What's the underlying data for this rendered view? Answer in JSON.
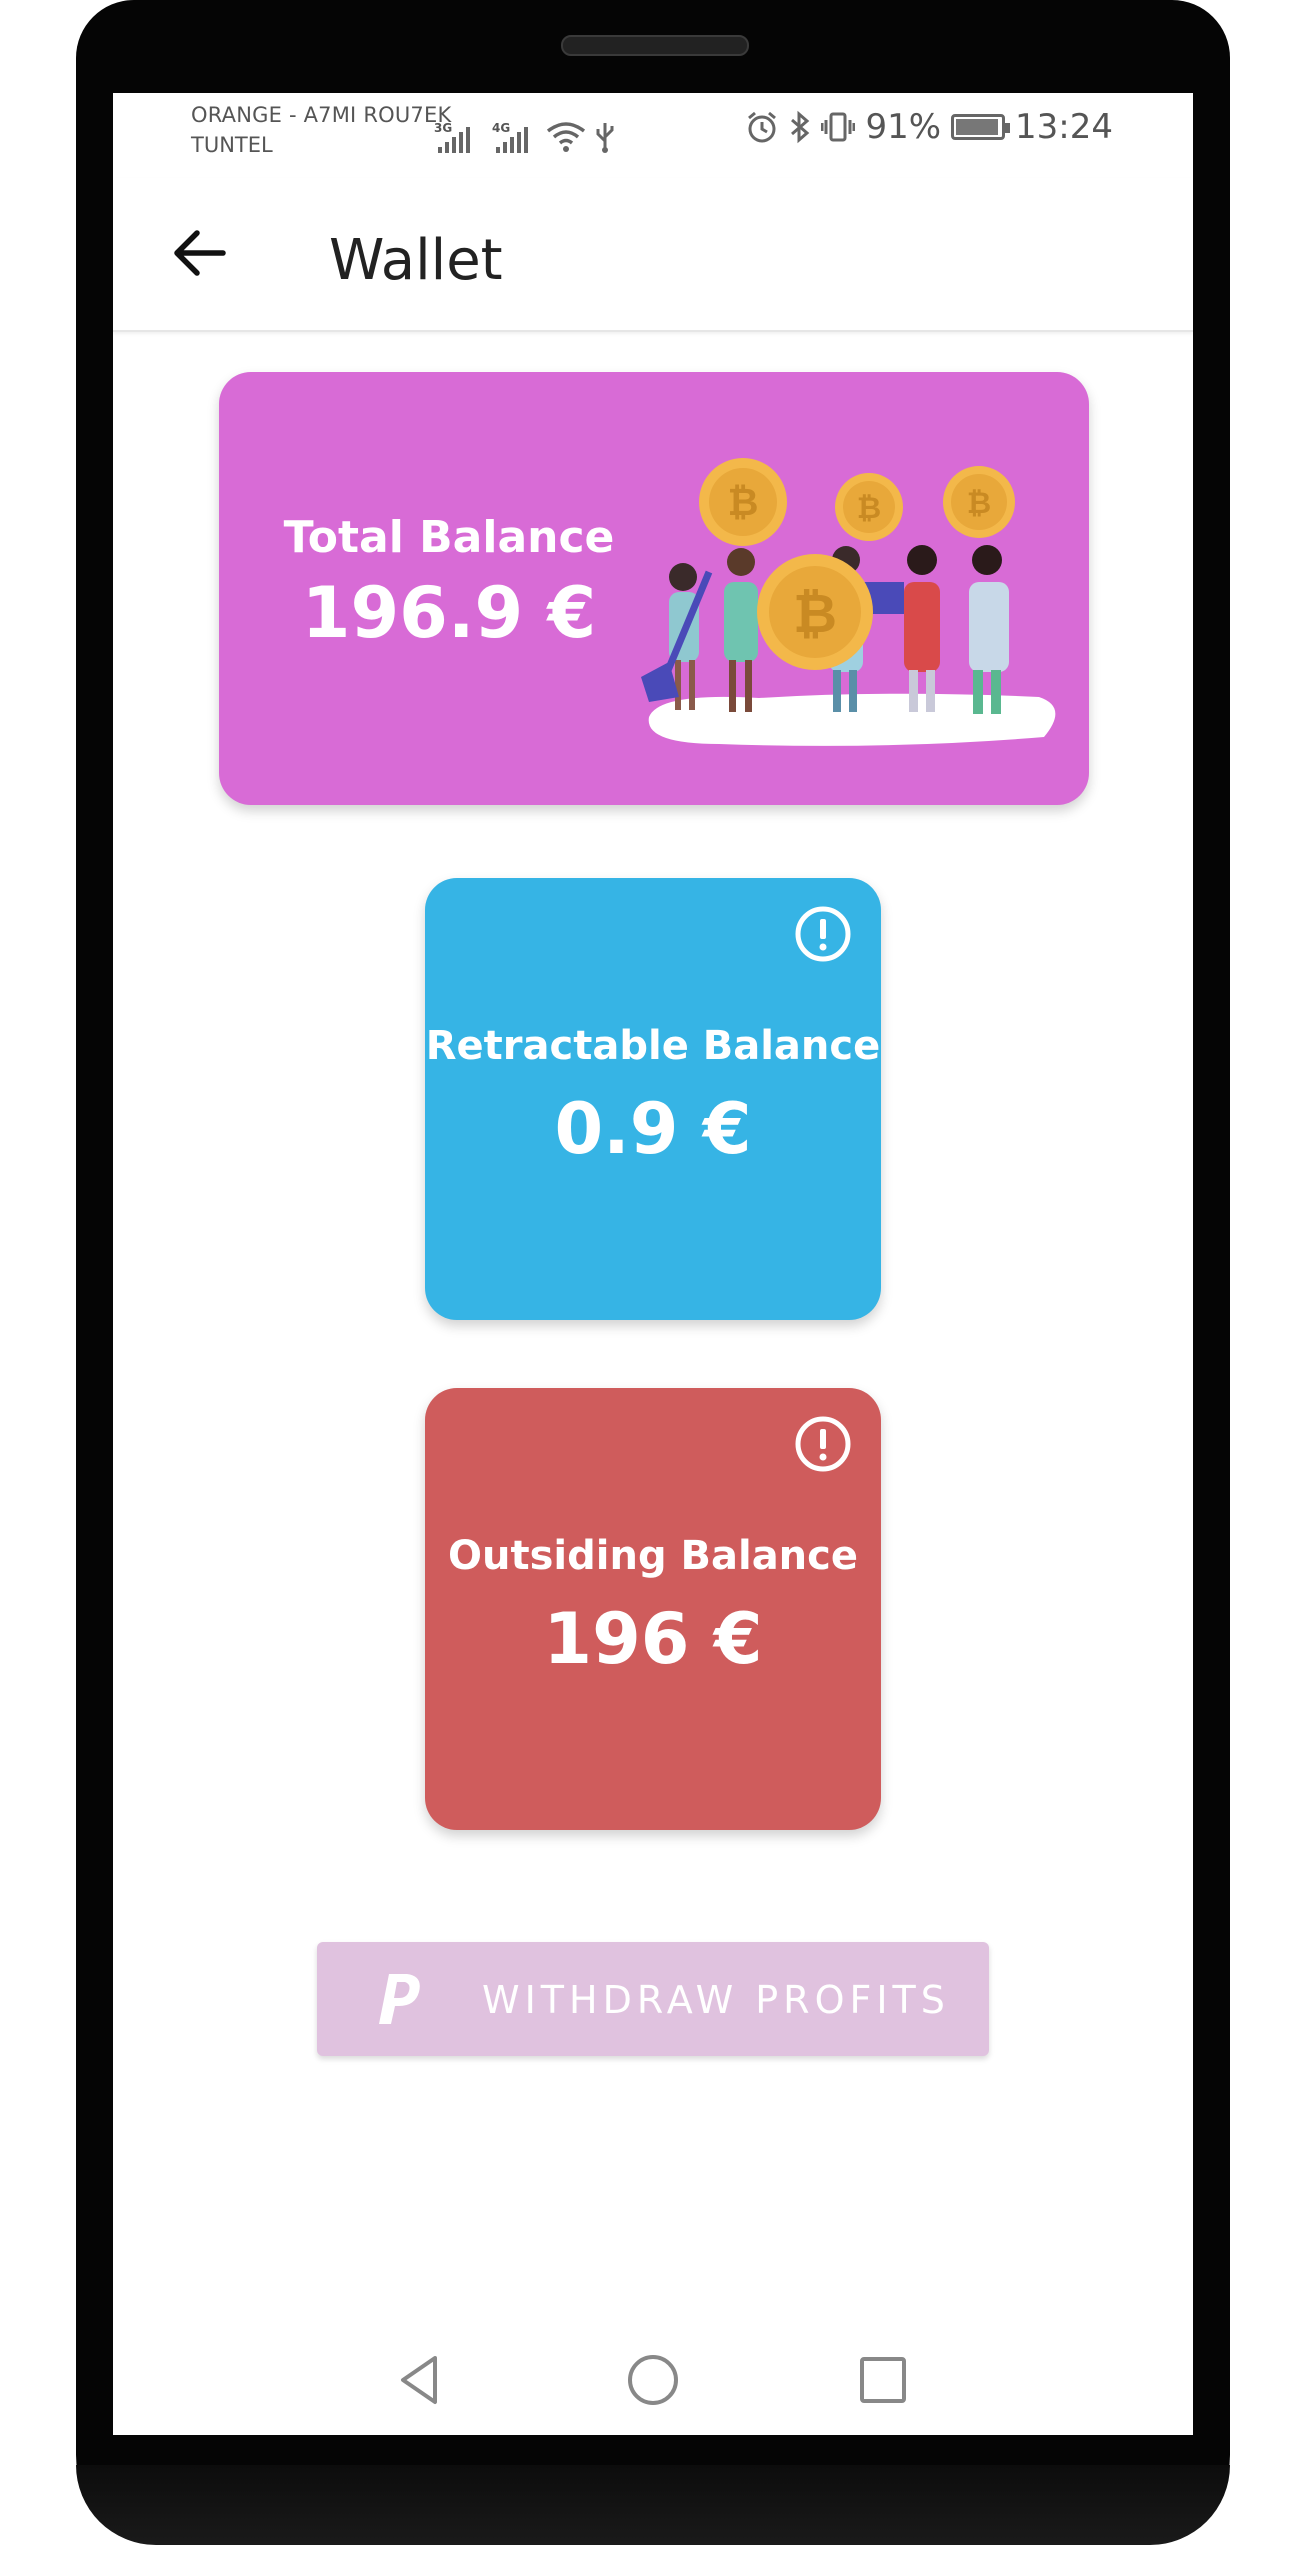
{
  "status_bar": {
    "carrier_line1": "ORANGE - A7MI ROU7EK",
    "carrier_line2": "TUNTEL",
    "network_badges": [
      "3G",
      "4G"
    ],
    "battery_percent": "91%",
    "battery_level": 0.91,
    "time": "13:24",
    "icons": [
      "signal-icon",
      "wifi-icon",
      "usb-icon",
      "alarm-icon",
      "bluetooth-icon",
      "vibrate-icon",
      "battery-icon"
    ]
  },
  "appbar": {
    "title": "Wallet",
    "back_icon": "arrow-left-icon"
  },
  "cards": {
    "total": {
      "label": "Total Balance",
      "value": "196.9 €",
      "color": "#d86bd6"
    },
    "retractable": {
      "label": "Retractable Balance",
      "value": "0.9 €",
      "color": "#36b4e5",
      "icon": "info-icon"
    },
    "outstanding": {
      "label": "Outsiding Balance",
      "value": "196 €",
      "color": "#cf5c5c",
      "icon": "info-icon"
    }
  },
  "withdraw": {
    "label": "WITHDRAW PROFITS",
    "icon": "paypal-icon",
    "color": "#e0c2df"
  },
  "navbar": {
    "icons": [
      "nav-back-icon",
      "nav-home-icon",
      "nav-recents-icon"
    ]
  }
}
